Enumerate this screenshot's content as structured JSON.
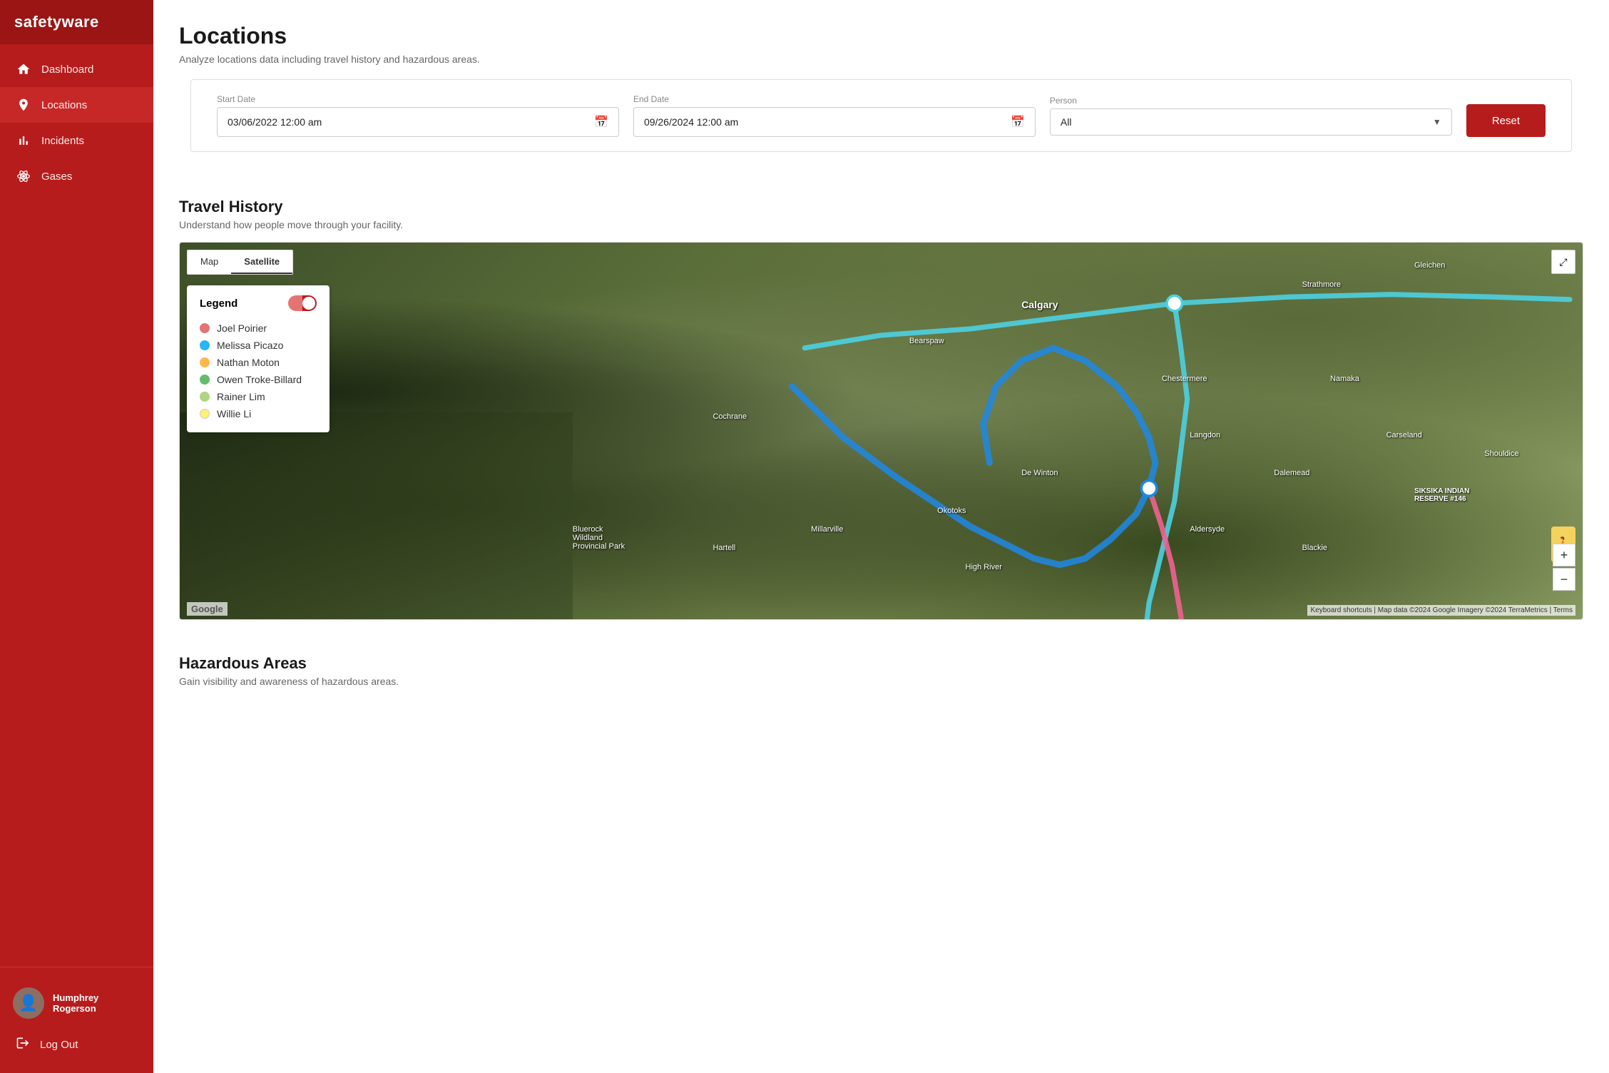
{
  "app": {
    "name": "safetyware"
  },
  "sidebar": {
    "nav_items": [
      {
        "id": "dashboard",
        "label": "Dashboard",
        "icon": "home"
      },
      {
        "id": "locations",
        "label": "Locations",
        "icon": "location",
        "active": true
      },
      {
        "id": "incidents",
        "label": "Incidents",
        "icon": "chart"
      },
      {
        "id": "gases",
        "label": "Gases",
        "icon": "atom"
      }
    ],
    "user": {
      "name": "Humphrey Rogerson",
      "avatar_emoji": "👤"
    },
    "logout_label": "Log Out"
  },
  "page": {
    "title": "Locations",
    "subtitle": "Analyze locations data including travel history and hazardous areas."
  },
  "filters": {
    "start_date_label": "Start Date",
    "start_date_value": "03/06/2022 12:00 am",
    "end_date_label": "End Date",
    "end_date_value": "09/26/2024 12:00 am",
    "person_label": "Person",
    "person_value": "All",
    "person_options": [
      "All",
      "Joel Poirier",
      "Melissa Picazo",
      "Nathan Moton",
      "Owen Troke-Billard",
      "Rainer Lim",
      "Willie Li"
    ],
    "reset_label": "Reset"
  },
  "travel_history": {
    "title": "Travel History",
    "subtitle": "Understand how people move through your facility.",
    "map_tabs": [
      "Map",
      "Satellite"
    ],
    "active_tab": "Satellite",
    "legend": {
      "title": "Legend",
      "items": [
        {
          "name": "Joel Poirier",
          "color": "#e57373"
        },
        {
          "name": "Melissa Picazo",
          "color": "#29b6f6"
        },
        {
          "name": "Nathan Moton",
          "color": "#ffb74d"
        },
        {
          "name": "Owen Troke-Billard",
          "color": "#66bb6a"
        },
        {
          "name": "Rainer Lim",
          "color": "#aed581"
        },
        {
          "name": "Willie Li",
          "color": "#fff176"
        }
      ]
    }
  },
  "map_controls": {
    "zoom_in": "+",
    "zoom_out": "−",
    "expand_icon": "⤢",
    "street_view_icon": "🚶"
  },
  "map_attribution": {
    "google_label": "Google",
    "attribution_text": "Keyboard shortcuts | Map data ©2024 Google Imagery ©2024 TerraMetrics | Terms"
  },
  "hazardous_areas": {
    "title": "Hazardous Areas",
    "subtitle": "Gain visibility and awareness of hazardous areas."
  }
}
